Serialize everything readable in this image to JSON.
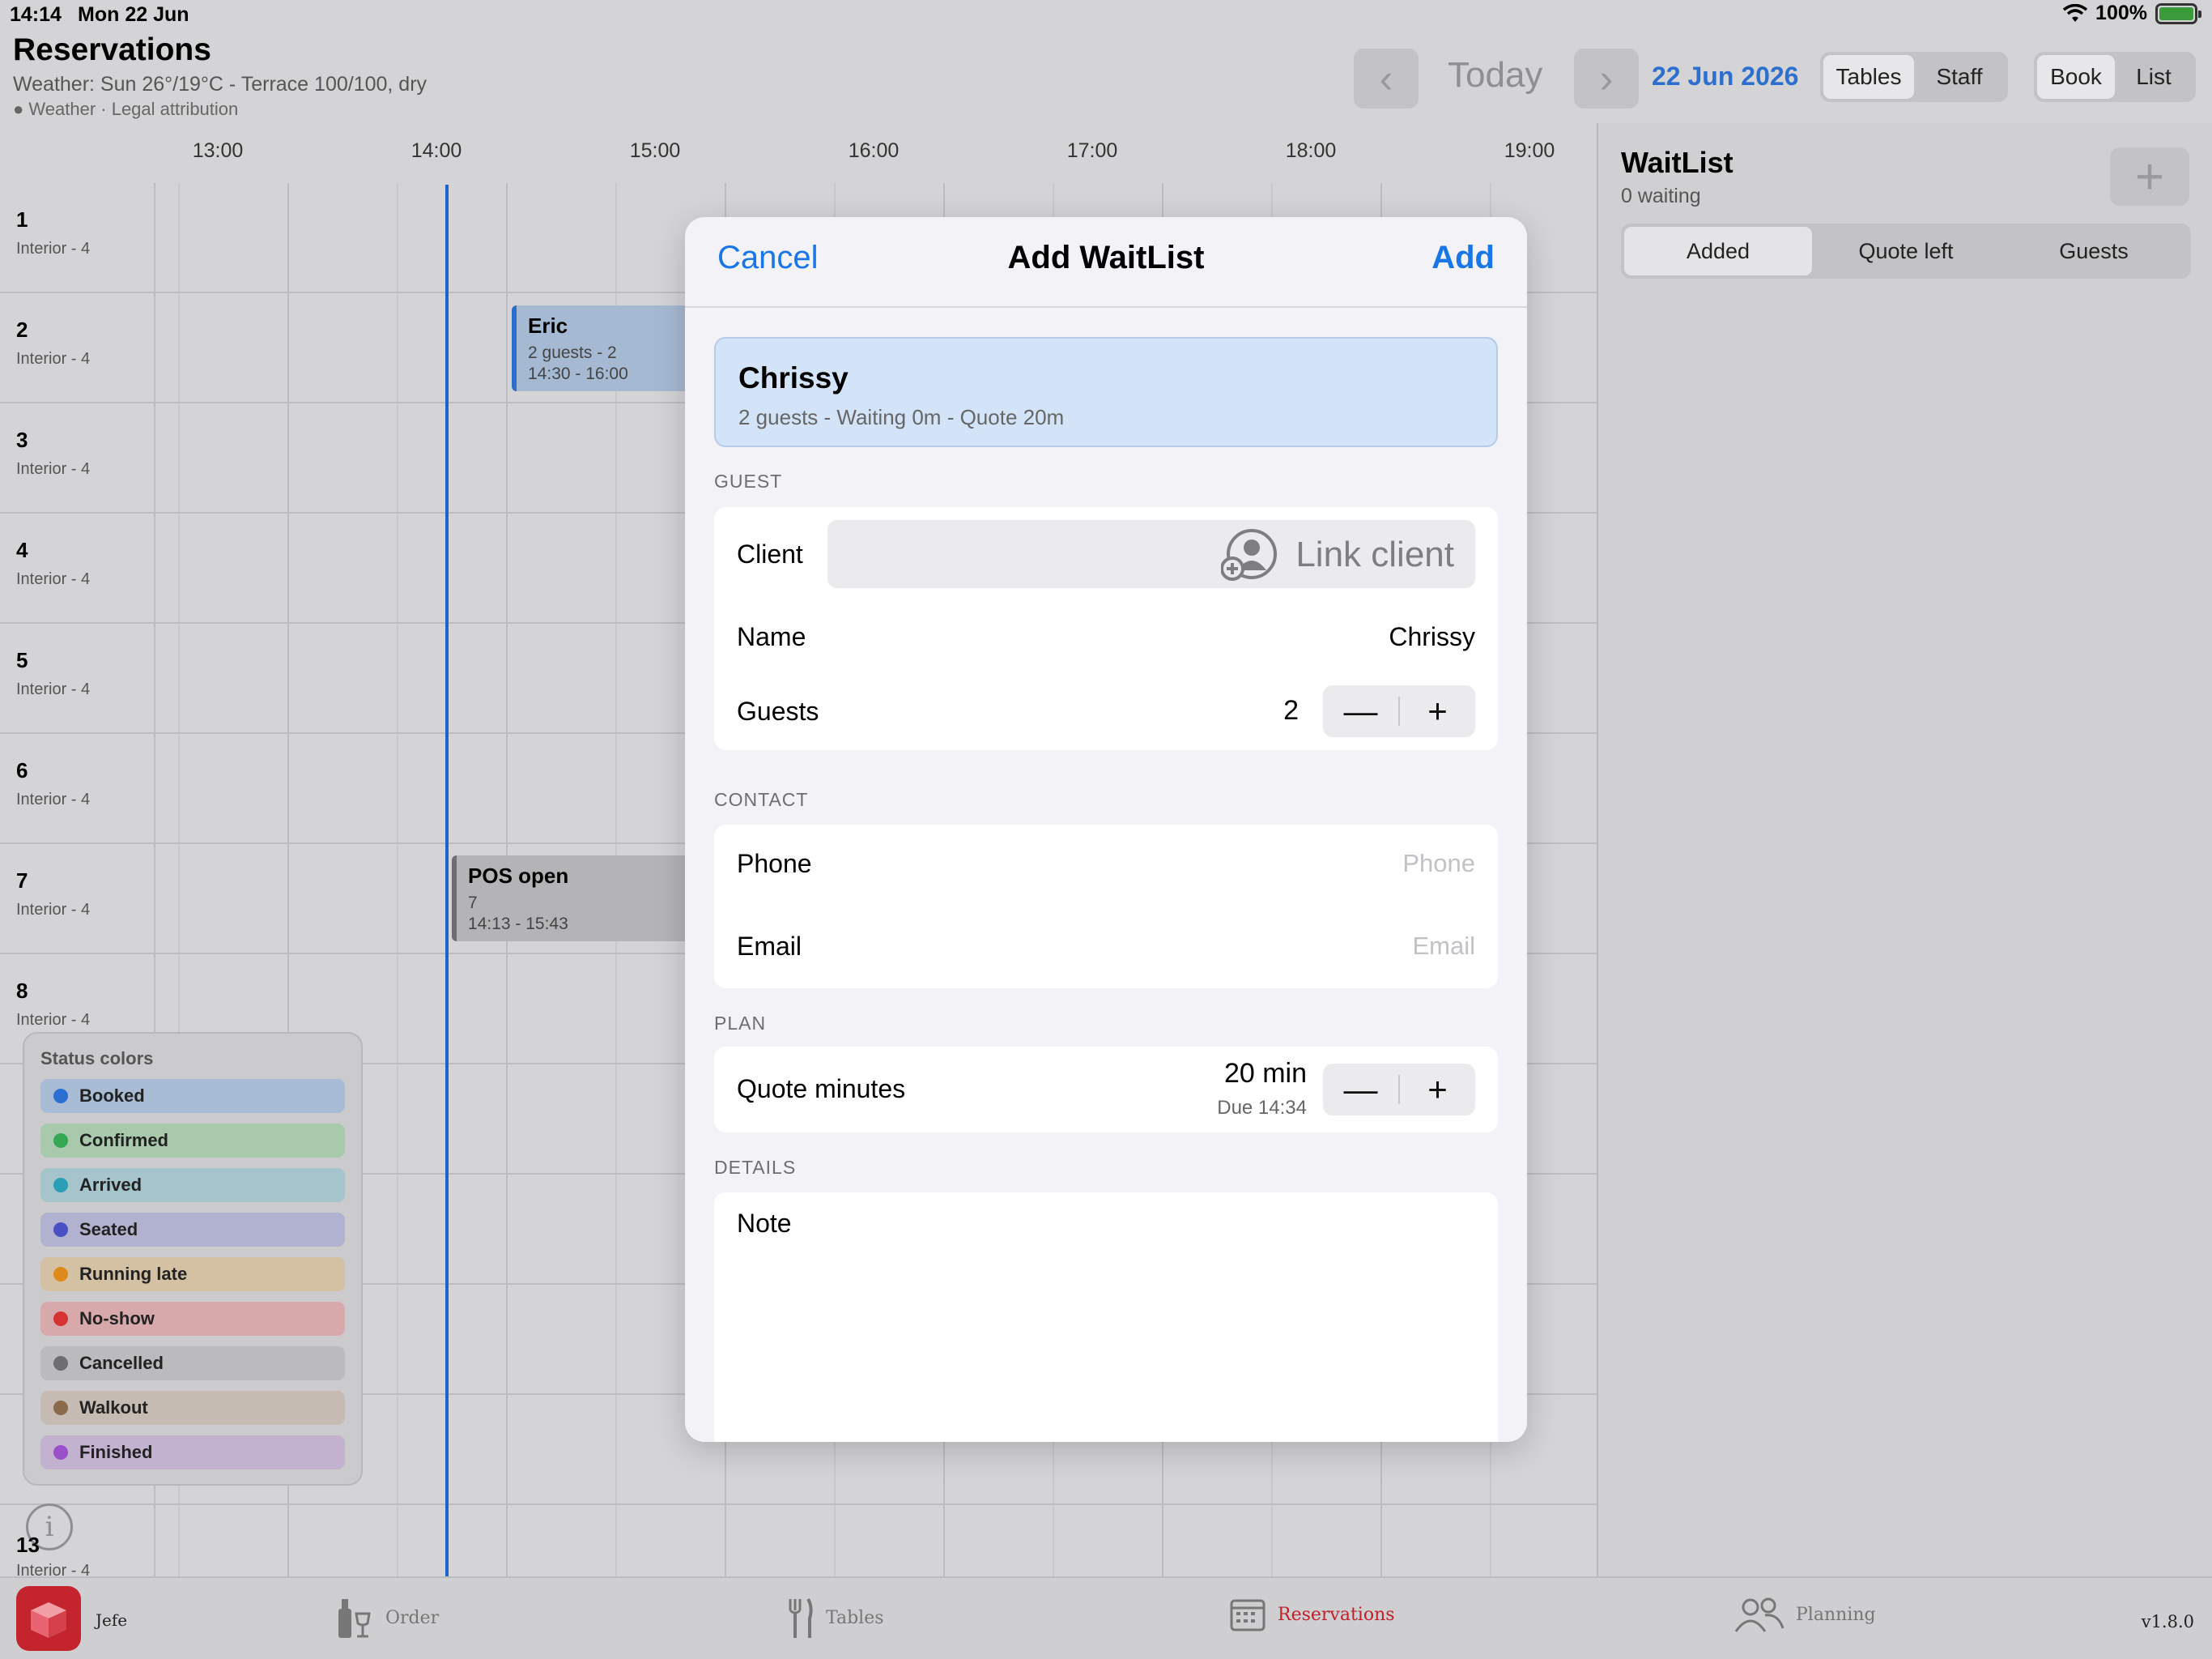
{
  "status_bar": {
    "time": "14:14",
    "date": "Mon 22 Jun",
    "battery": "100%",
    "battery_level": 1.0
  },
  "header": {
    "title": "Reservations",
    "weather": "Weather: Sun 26°/19°C - Terrace 100/100, dry",
    "attribution": "Weather · Legal attribution",
    "today_label": "Today",
    "current_date": "22 Jun 2026",
    "view_segment": [
      "Tables",
      "Staff"
    ],
    "view_selected": "Tables",
    "mode_segment": [
      "Book",
      "List"
    ],
    "mode_selected": "Book"
  },
  "timeline": {
    "hours": [
      "13:00",
      "14:00",
      "15:00",
      "16:00",
      "17:00",
      "18:00",
      "19:00"
    ],
    "now_time": "14:13",
    "tables": [
      {
        "num": "1",
        "area": "Interior - 4"
      },
      {
        "num": "2",
        "area": "Interior - 4"
      },
      {
        "num": "3",
        "area": "Interior - 4"
      },
      {
        "num": "4",
        "area": "Interior - 4"
      },
      {
        "num": "5",
        "area": "Interior - 4"
      },
      {
        "num": "6",
        "area": "Interior - 4"
      },
      {
        "num": "7",
        "area": "Interior - 4"
      },
      {
        "num": "8",
        "area": "Interior - 4"
      }
    ],
    "table13": {
      "num": "13",
      "area": "Interior - 4"
    },
    "reservations": [
      {
        "name": "Eric",
        "line2": "2 guests - 2",
        "line3": "14:30 - 16:00",
        "table": "2",
        "status": "Booked"
      },
      {
        "name": "POS open",
        "line2": "7",
        "line3": "14:13 - 15:43",
        "table": "7",
        "status": "Cancelled"
      }
    ]
  },
  "legend": {
    "title": "Status colors",
    "items": [
      {
        "label": "Booked",
        "dot": "#2a6fd1",
        "bg": "#a8bcd6"
      },
      {
        "label": "Confirmed",
        "dot": "#35a853",
        "bg": "#a9c9ac"
      },
      {
        "label": "Arrived",
        "dot": "#2a9fb5",
        "bg": "#a6c4cb"
      },
      {
        "label": "Seated",
        "dot": "#4a4fc3",
        "bg": "#b1b2cf"
      },
      {
        "label": "Running late",
        "dot": "#de8a1a",
        "bg": "#d4c1a4"
      },
      {
        "label": "No-show",
        "dot": "#d63333",
        "bg": "#d7a9ab"
      },
      {
        "label": "Cancelled",
        "dot": "#6e6e72",
        "bg": "#bbbbbe"
      },
      {
        "label": "Walkout",
        "dot": "#8a6a4a",
        "bg": "#c5bbb2"
      },
      {
        "label": "Finished",
        "dot": "#9a50c8",
        "bg": "#c3b2cf"
      }
    ]
  },
  "waitlist": {
    "title": "WaitList",
    "count_text": "0 waiting",
    "tabs": [
      "Added",
      "Quote left",
      "Guests"
    ],
    "selected_tab": "Added"
  },
  "modal": {
    "cancel": "Cancel",
    "title": "Add WaitList",
    "add": "Add",
    "preview_name": "Chrissy",
    "preview_sub": "2 guests - Waiting 0m - Quote 20m",
    "guest_section": "GUEST",
    "client_label": "Client",
    "link_client": "Link client",
    "name_label": "Name",
    "name_value": "Chrissy",
    "guests_label": "Guests",
    "guests_value": "2",
    "contact_section": "CONTACT",
    "phone_label": "Phone",
    "phone_placeholder": "Phone",
    "email_label": "Email",
    "email_placeholder": "Email",
    "plan_section": "PLAN",
    "quote_label": "Quote minutes",
    "quote_value": "20 min",
    "quote_due": "Due 14:34",
    "details_section": "DETAILS",
    "note_label": "Note"
  },
  "tabbar": {
    "user": "Jefe",
    "tabs": [
      "Order",
      "Tables",
      "Reservations",
      "Planning"
    ],
    "selected": "Reservations",
    "version": "v1.8.0"
  },
  "colors": {
    "accent": "#1976e8",
    "now_line": "#1e63c9",
    "tab_selected": "#c0202a"
  }
}
